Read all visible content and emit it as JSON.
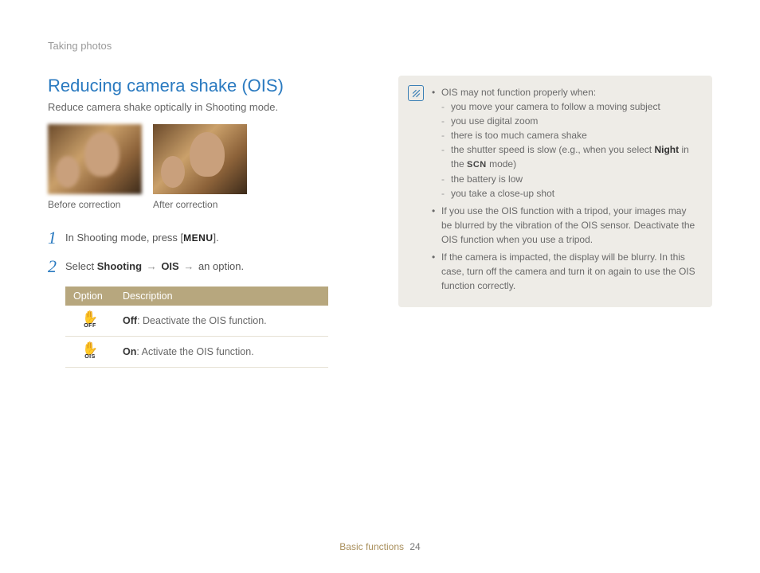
{
  "breadcrumb": "Taking photos",
  "heading": "Reducing camera shake (OIS)",
  "subheading": "Reduce camera shake optically in Shooting mode.",
  "images": {
    "before_caption": "Before correction",
    "after_caption": "After correction"
  },
  "steps": {
    "s1_num": "1",
    "s1_a": "In Shooting mode, press [",
    "s1_menu": "MENU",
    "s1_b": "].",
    "s2_num": "2",
    "s2_a": "Select ",
    "s2_shooting": "Shooting",
    "s2_arrow": " → ",
    "s2_ois": "OIS",
    "s2_b": " → an option."
  },
  "table": {
    "header_option": "Option",
    "header_desc": "Description",
    "row_off_sub": "OFF",
    "row_off_label": "Off",
    "row_off_desc": ": Deactivate the OIS function.",
    "row_on_sub": "OIS",
    "row_on_label": "On",
    "row_on_desc": ": Activate the OIS function."
  },
  "note": {
    "b1": "OIS may not function properly when:",
    "b1_s1": "you move your camera to follow a moving subject",
    "b1_s2": "you use digital zoom",
    "b1_s3": "there is too much camera shake",
    "b1_s4a": "the shutter speed is slow (e.g., when you select ",
    "b1_s4_night": "Night",
    "b1_s4b": " in the ",
    "b1_s4_scn": "SCN",
    "b1_s4c": " mode)",
    "b1_s5": "the battery is low",
    "b1_s6": "you take a close-up shot",
    "b2": "If you use the OIS function with a tripod, your images may be blurred by the vibration of the OIS sensor. Deactivate the OIS function when you use a tripod.",
    "b3": "If the camera is impacted, the display will be blurry. In this case, turn off the camera and turn it on again to use the OIS function correctly."
  },
  "footer": {
    "section": "Basic functions",
    "page": "24"
  }
}
